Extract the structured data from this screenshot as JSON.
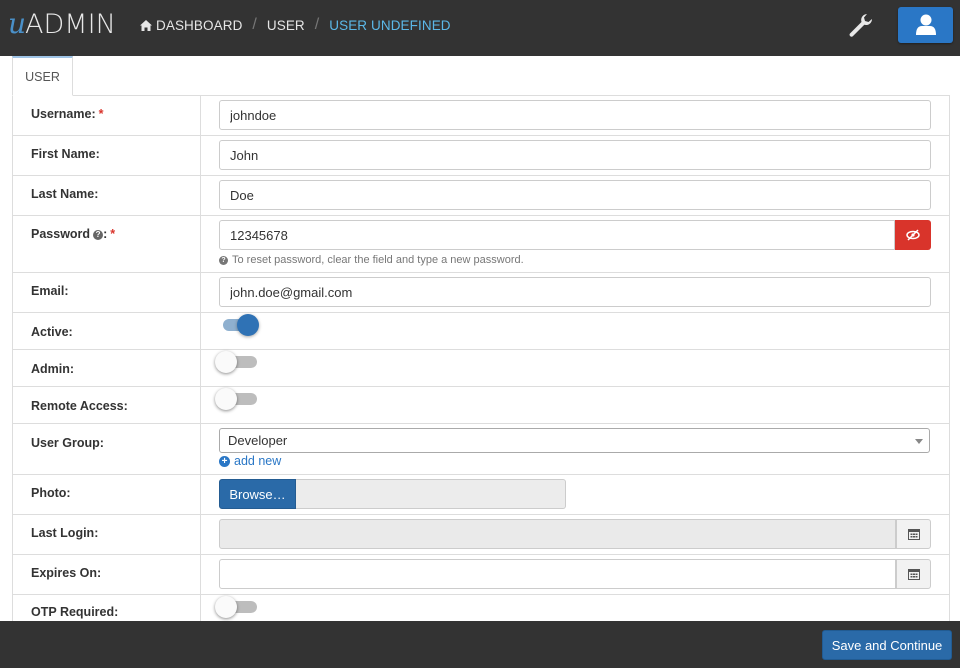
{
  "app": {
    "logo_prefix": "u",
    "logo_text": "ADMIN"
  },
  "breadcrumb": [
    {
      "label": "DASHBOARD",
      "icon": "home-icon"
    },
    {
      "label": "USER"
    },
    {
      "label": "USER UNDEFINED",
      "active": true
    }
  ],
  "header": {
    "settings_icon": "wrench-icon",
    "user_icon": "user-icon"
  },
  "tabs": [
    {
      "label": "USER",
      "active": true
    }
  ],
  "form": {
    "username": {
      "label": "Username:",
      "required": "*",
      "value": "johndoe"
    },
    "first_name": {
      "label": "First Name:",
      "value": "John"
    },
    "last_name": {
      "label": "Last Name:",
      "value": "Doe"
    },
    "password": {
      "label": "Password",
      "label_suffix": ":",
      "required": "*",
      "value": "12345678",
      "help": "To reset password, clear the field and type a new password.",
      "toggle_icon": "eye-slash-icon"
    },
    "email": {
      "label": "Email:",
      "value": "john.doe@gmail.com"
    },
    "active": {
      "label": "Active:",
      "on": true
    },
    "admin": {
      "label": "Admin:",
      "on": false
    },
    "remote_access": {
      "label": "Remote Access:",
      "on": false
    },
    "user_group": {
      "label": "User Group:",
      "selected": "Developer",
      "add_new": "add new"
    },
    "photo": {
      "label": "Photo:",
      "browse": "Browse…"
    },
    "last_login": {
      "label": "Last Login:",
      "value": ""
    },
    "expires_on": {
      "label": "Expires On:",
      "value": ""
    },
    "otp_required": {
      "label": "OTP Required:",
      "on": false
    }
  },
  "footer": {
    "save_label": "Save and Continue"
  },
  "colors": {
    "topbar": "#333333",
    "primary": "#2a6aa8",
    "danger": "#d9342b",
    "link": "#5bb8e8"
  }
}
